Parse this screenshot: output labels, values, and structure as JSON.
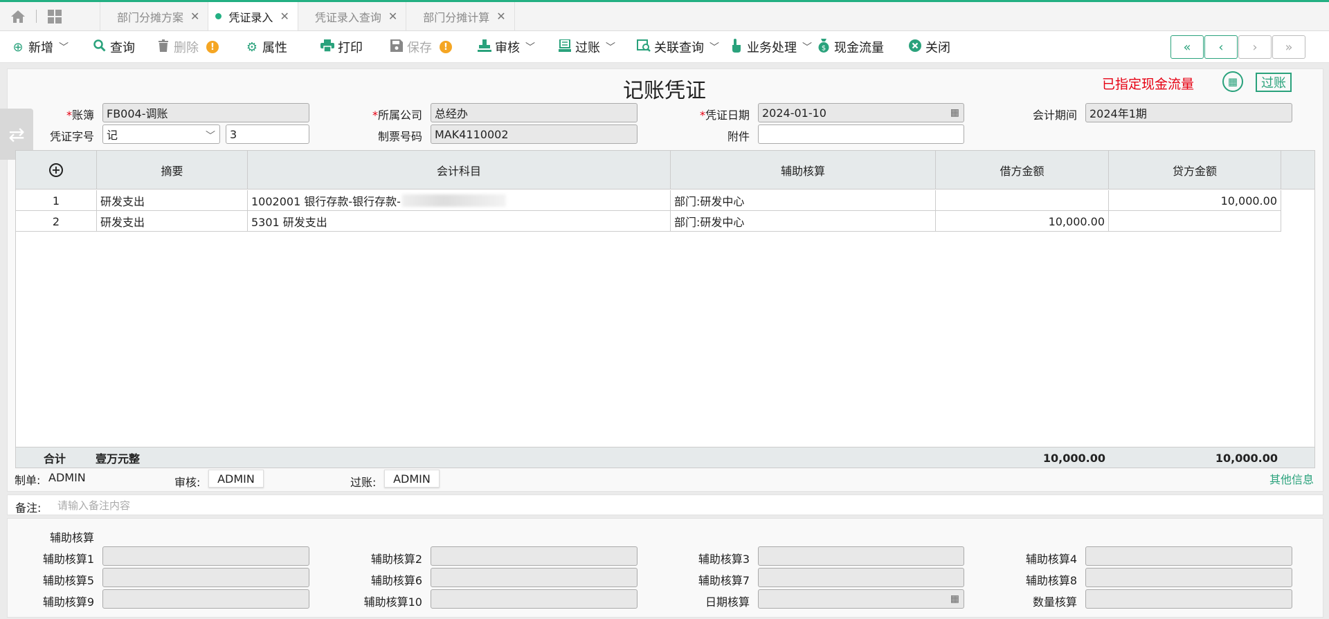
{
  "tabs": [
    {
      "label": "部门分摊方案",
      "active": false
    },
    {
      "label": "凭证录入",
      "active": true
    },
    {
      "label": "凭证录入查询",
      "active": false
    },
    {
      "label": "部门分摊计算",
      "active": false
    }
  ],
  "toolbar": {
    "add": "新增",
    "query": "查询",
    "delete": "删除",
    "properties": "属性",
    "print": "打印",
    "save": "保存",
    "review": "审核",
    "post": "过账",
    "related_query": "关联查询",
    "business": "业务处理",
    "cash_flow": "现金流量",
    "close": "关闭",
    "warn_mark": "!"
  },
  "voucher": {
    "title": "记账凭证",
    "cash_flow_status": "已指定现金流量",
    "posted_stamp": "过账",
    "fields": {
      "ledger_label": "账簿",
      "ledger_value": "FB004-调账",
      "company_label": "所属公司",
      "company_value": "总经办",
      "date_label": "凭证日期",
      "date_value": "2024-01-10",
      "period_label": "会计期间",
      "period_value": "2024年1期",
      "word_label": "凭证字号",
      "word_value": "记",
      "number_value": "3",
      "ticket_label": "制票号码",
      "ticket_value": "MAK4110002",
      "attachment_label": "附件",
      "attachment_value": ""
    }
  },
  "table": {
    "columns": [
      "摘要",
      "会计科目",
      "辅助核算",
      "借方金额",
      "贷方金额"
    ],
    "rows": [
      {
        "no": "1",
        "summary": "研发支出",
        "account": "1002001 银行存款-银行存款-",
        "aux": "部门:研发中心",
        "debit": "",
        "credit": "10,000.00"
      },
      {
        "no": "2",
        "summary": "研发支出",
        "account": "5301 研发支出",
        "aux": "部门:研发中心",
        "debit": "10,000.00",
        "credit": ""
      }
    ],
    "total": {
      "label": "合计",
      "words": "壹万元整",
      "debit": "10,000.00",
      "credit": "10,000.00"
    }
  },
  "signatures": {
    "maker_label": "制单:",
    "maker_value": "ADMIN",
    "reviewer_label": "审核:",
    "reviewer_value": "ADMIN",
    "poster_label": "过账:",
    "poster_value": "ADMIN",
    "other_info": "其他信息"
  },
  "remarks": {
    "label": "备注:",
    "placeholder": "请输入备注内容"
  },
  "aux_section": {
    "title": "辅助核算",
    "fields": [
      "辅助核算1",
      "辅助核算2",
      "辅助核算3",
      "辅助核算4",
      "辅助核算5",
      "辅助核算6",
      "辅助核算7",
      "辅助核算8",
      "辅助核算9",
      "辅助核算10",
      "日期核算",
      "数量核算"
    ]
  },
  "colors": {
    "accent": "#23b083",
    "alert": "#e60012",
    "warning": "#f5a623"
  },
  "icons": [
    "home-icon",
    "grid-icon",
    "plus-circle-icon",
    "search-icon",
    "trash-icon",
    "gear-icon",
    "printer-icon",
    "save-icon",
    "stamp-icon",
    "ledger-icon",
    "link-search-icon",
    "hand-pointer-icon",
    "money-bag-icon",
    "close-circle-icon",
    "first-page-icon",
    "prev-page-icon",
    "next-page-icon",
    "last-page-icon",
    "calendar-icon",
    "swap-icon"
  ]
}
